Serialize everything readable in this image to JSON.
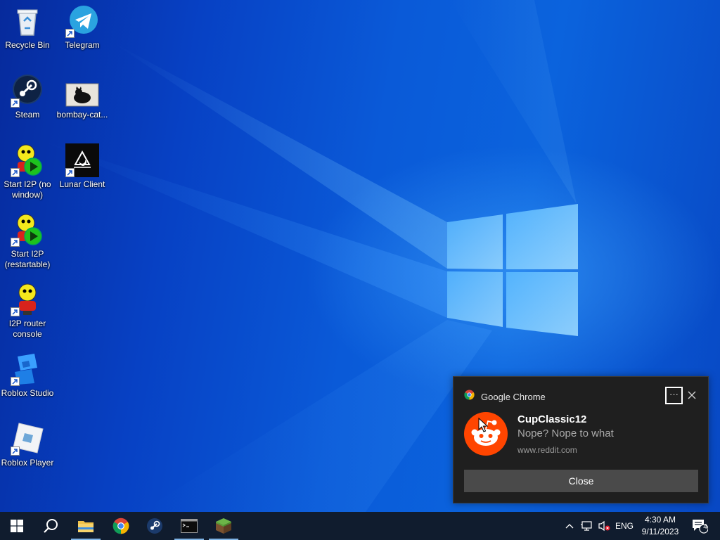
{
  "desktop": {
    "icons": [
      {
        "label": "Recycle Bin",
        "icon": "recycle-bin-icon"
      },
      {
        "label": "Telegram",
        "icon": "telegram-icon"
      },
      {
        "label": "Steam",
        "icon": "steam-icon"
      },
      {
        "label": "bombay-cat...",
        "icon": "image-thumbnail-icon"
      },
      {
        "label": "Start I2P (no window)",
        "icon": "i2p-start-icon"
      },
      {
        "label": "Lunar Client",
        "icon": "lunar-client-icon"
      },
      {
        "label": "Start I2P (restartable)",
        "icon": "i2p-restart-icon"
      },
      {
        "label": "I2P router console",
        "icon": "i2p-console-icon"
      },
      {
        "label": "Roblox Studio",
        "icon": "roblox-studio-icon"
      },
      {
        "label": "Roblox Player",
        "icon": "roblox-player-icon"
      }
    ]
  },
  "notification": {
    "app_name": "Google Chrome",
    "more_label": "···",
    "sender": "CupClassic12",
    "message": "Nope?  Nope to what",
    "source": "www.reddit.com",
    "close_button_label": "Close"
  },
  "taskbar": {
    "pinned": [
      {
        "name": "start-button",
        "icon": "windows-logo-icon"
      },
      {
        "name": "search-button",
        "icon": "search-icon"
      },
      {
        "name": "file-explorer",
        "icon": "folder-icon"
      },
      {
        "name": "google-chrome",
        "icon": "chrome-icon"
      },
      {
        "name": "steam",
        "icon": "steam-icon"
      },
      {
        "name": "command-prompt",
        "icon": "terminal-icon"
      },
      {
        "name": "minecraft",
        "icon": "grass-block-icon"
      }
    ],
    "tray": {
      "language": "ENG",
      "time": "4:30 AM",
      "date": "9/11/2023",
      "notification_count": "4"
    }
  },
  "colors": {
    "taskbar": "#101c2e",
    "toast_bg": "#1f1f1f",
    "reddit_orange": "#ff4500",
    "desktop_blue": "#0a5ad8"
  }
}
